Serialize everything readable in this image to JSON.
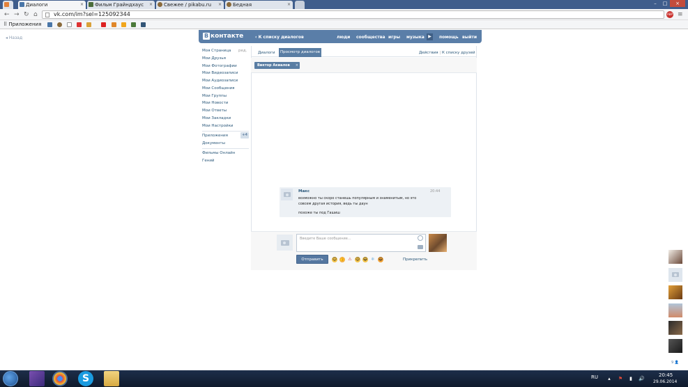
{
  "browser": {
    "tabs": [
      {
        "title": "Диалоги",
        "icon": "vk-favicon"
      },
      {
        "title": "Фильм Грайндхаус",
        "icon": "film-favicon"
      },
      {
        "title": "Свежее / pikabu.ru",
        "icon": "pikabu-favicon"
      },
      {
        "title": "Бедная",
        "icon": "pikabu-favicon"
      }
    ],
    "url": "vk.com/im?sel=125092344",
    "bookmarks_label": "Приложения"
  },
  "page": {
    "back_label": "Назад",
    "header": {
      "logo_text": "контакте",
      "logo_letter": "В",
      "back_to_dialogs": "К списку диалогов",
      "menu": [
        "люди",
        "сообщества",
        "игры",
        "музыка",
        "помощь",
        "выйти"
      ]
    },
    "sidebar": {
      "edit_label": "ред.",
      "items": [
        "Моя Страница",
        "Мои Друзья",
        "Мои Фотографии",
        "Мои Видеозаписи",
        "Мои Аудиозаписи",
        "Мои Сообщения",
        "Мои Группы",
        "Мои Новости",
        "Мои Ответы",
        "Мои Закладки",
        "Мои Настройки"
      ],
      "apps_label": "Приложения",
      "apps_badge": "+4",
      "docs_label": "Документы",
      "extra_items": [
        "Фильмы Онлайн",
        "Гений"
      ]
    },
    "tabs": {
      "dialogs": "Диалоги",
      "view_dialogs": "Просмотр диалогов",
      "actions": "Действия",
      "to_friends": "К списку друзей"
    },
    "peer_name": "Виктор Акиалов",
    "message": {
      "author": "Макс",
      "time": "20:44",
      "lines": [
        "возможно ты скоро станешь популярным и знаменитым, но это",
        "совсем другая история, ведь ты даун",
        "похоже ты под Гашиш"
      ]
    },
    "composer": {
      "placeholder": "Введите Ваше сообщение...",
      "send_label": "Отправить",
      "attach_label": "Прикрепить",
      "emoji": [
        "😊",
        "👍",
        "⚠",
        "😉",
        "😄",
        "❄",
        "😃"
      ]
    },
    "right_strip_count": "9"
  },
  "taskbar": {
    "lang": "RU",
    "time": "20:45",
    "date": "29.06.2014"
  }
}
